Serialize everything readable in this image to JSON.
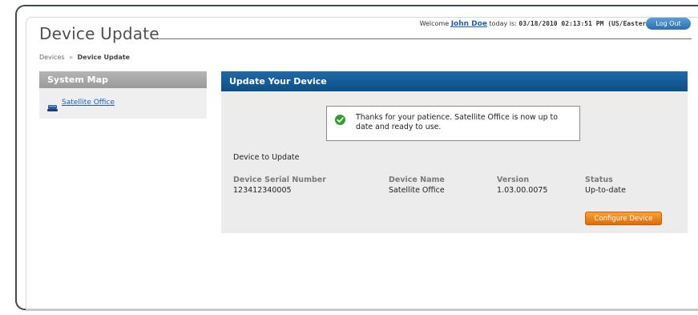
{
  "page": {
    "title": "Device Update"
  },
  "header": {
    "welcome_prefix": "Welcome",
    "user_name": "John Doe",
    "today_prefix": "today is:",
    "datetime": "03/18/2010 02:13:51 PM (US/Eastern)",
    "logout_label": "Log Out"
  },
  "breadcrumb": {
    "root": "Devices",
    "separator": "»",
    "current": "Device Update"
  },
  "sidebar": {
    "title": "System Map",
    "items": [
      {
        "label": "Satellite Office",
        "icon": "device-icon"
      }
    ]
  },
  "panel": {
    "title": "Update Your Device",
    "message": "Thanks for your patience. Satellite Office is now up to date and ready to use.",
    "section_label": "Device to Update",
    "columns": [
      {
        "header": "Device Serial Number",
        "value": "123412340005"
      },
      {
        "header": "Device Name",
        "value": "Satellite Office"
      },
      {
        "header": "Version",
        "value": "1.03.00.0075"
      },
      {
        "header": "Status",
        "value": "Up-to-date"
      }
    ],
    "configure_label": "Configure Device"
  },
  "colors": {
    "panel_header": "#0d4f86",
    "link": "#1a5fb0",
    "configure_button": "#e26b00",
    "success": "#2f9e2f"
  }
}
